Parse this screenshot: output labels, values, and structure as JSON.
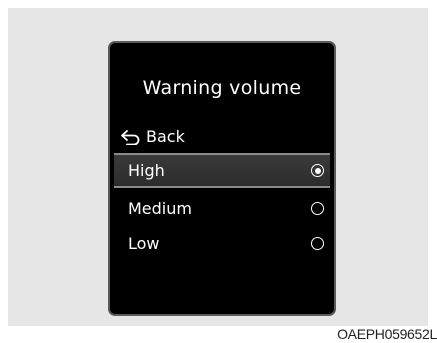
{
  "screen": {
    "title": "Warning volume",
    "back_label": "Back",
    "options": [
      {
        "label": "High",
        "selected": true
      },
      {
        "label": "Medium",
        "selected": false
      },
      {
        "label": "Low",
        "selected": false
      }
    ]
  },
  "caption": "OAEPH059652L",
  "colors": {
    "screen_background": "#000000",
    "selection_background": "#333333",
    "text": "#ffffff",
    "backdrop": "#e6e6e6"
  }
}
